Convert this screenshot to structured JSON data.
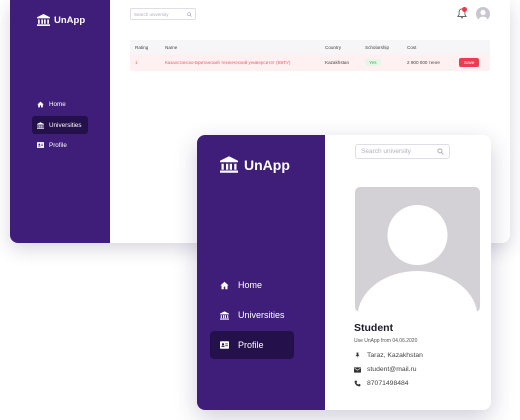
{
  "colors": {
    "sidebar": "#3f1e79",
    "sidebar_active": "#24104a",
    "save": "#ef3b52",
    "scholarship": "#3fae52",
    "notification": "#e83b4a"
  },
  "back_window": {
    "logo": "UnApp",
    "nav": [
      {
        "label": "Home",
        "icon": "home-icon"
      },
      {
        "label": "Universities",
        "icon": "university-icon",
        "active": true
      },
      {
        "label": "Profile",
        "icon": "profile-card-icon"
      }
    ],
    "search": {
      "placeholder": "Search university"
    },
    "notification_icon": "bell-icon",
    "table": {
      "headers": [
        "Rating",
        "Name",
        "Country",
        "Scholarship",
        "Cost"
      ],
      "rows": [
        {
          "rating": "1",
          "name": "Казахстанско-Британский технический университет (КБТУ)",
          "country": "Kazakhstan",
          "scholarship": "Yes",
          "cost": "2 900 000 тенге",
          "action": "Save"
        }
      ]
    }
  },
  "front_window": {
    "logo": "UnApp",
    "nav": [
      {
        "label": "Home",
        "icon": "home-icon"
      },
      {
        "label": "Universities",
        "icon": "university-icon"
      },
      {
        "label": "Profile",
        "icon": "profile-card-icon",
        "active": true
      }
    ],
    "search": {
      "placeholder": "Search university"
    },
    "profile": {
      "name": "Student",
      "since": "Use UnApp from 04.06.2020",
      "location": "Taraz, Kazakhstan",
      "email": "student@mail.ru",
      "phone": "87071498484"
    }
  }
}
